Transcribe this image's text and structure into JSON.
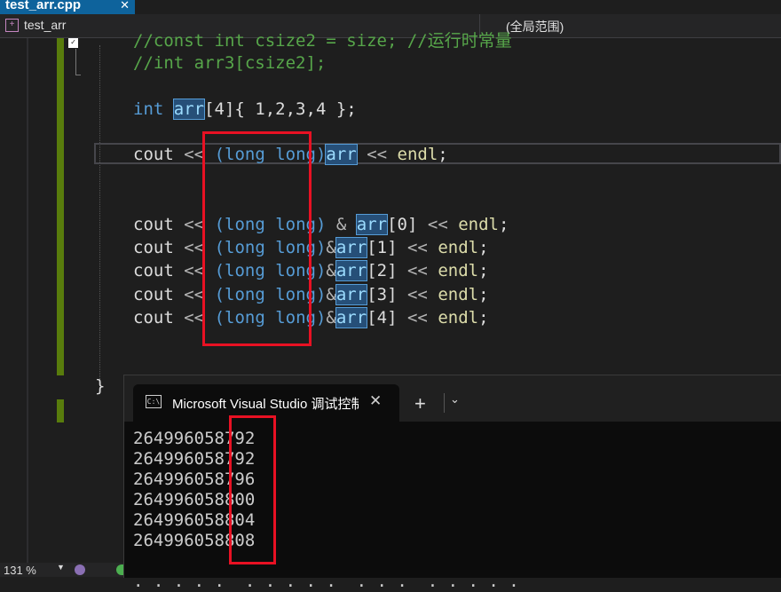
{
  "file_tab": {
    "name": "test_arr.cpp",
    "close": "✕"
  },
  "navbar": {
    "project": "test_arr",
    "scope": "(全局范围)"
  },
  "editor": {
    "comments": [
      "//const int csize2 = size; //运行时常量",
      "//int arr3[csize2];"
    ],
    "decl": {
      "type": "int",
      "name": "arr",
      "rest": "[4]{ 1,2,3,4 };"
    },
    "cout_word": "cout",
    "shift_op": "<<",
    "cast": "(long long)",
    "amp": "&",
    "endl": "endl",
    "semi": ";",
    "arr_name": "arr",
    "indexed_lines": [
      {
        "index": "[0]",
        "spaced": true
      },
      {
        "index": "[1]",
        "spaced": false
      },
      {
        "index": "[2]",
        "spaced": false
      },
      {
        "index": "[3]",
        "spaced": false
      },
      {
        "index": "[4]",
        "spaced": false
      }
    ],
    "closing_brace": "}"
  },
  "terminal": {
    "tab_title": "Microsoft Visual Studio 调试控制台",
    "icon_label": "C:\\",
    "close": "✕",
    "add": "+",
    "dropdown": "⌄",
    "output": [
      "264996058792",
      "264996058792",
      "264996058796",
      "264996058800",
      "264996058804",
      "264996058808"
    ]
  },
  "statusbar": {
    "zoom": "131 %"
  },
  "colors": {
    "highlight_box": "#e81123",
    "accent": "#0e639c",
    "change_bar": "#587c0c"
  }
}
